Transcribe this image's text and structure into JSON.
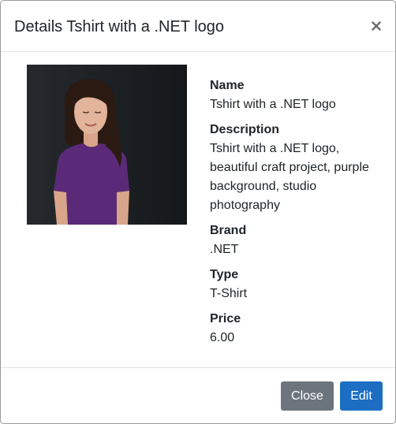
{
  "modal": {
    "title": "Details Tshirt with a .NET logo",
    "close_glyph": "×"
  },
  "product": {
    "image_alt": "Tshirt with a .NET logo",
    "fields": [
      {
        "label": "Name",
        "value": "Tshirt with a .NET logo"
      },
      {
        "label": "Description",
        "value": "Tshirt with a .NET logo, beautiful craft project, purple background, studio photography"
      },
      {
        "label": "Brand",
        "value": ".NET"
      },
      {
        "label": "Type",
        "value": "T-Shirt"
      },
      {
        "label": "Price",
        "value": "6.00"
      }
    ]
  },
  "footer": {
    "close_label": "Close",
    "edit_label": "Edit"
  },
  "colors": {
    "primary": "#1b6ec2",
    "secondary": "#6c757d",
    "photo_background": "#1f2327",
    "shirt": "#5a2a78"
  }
}
